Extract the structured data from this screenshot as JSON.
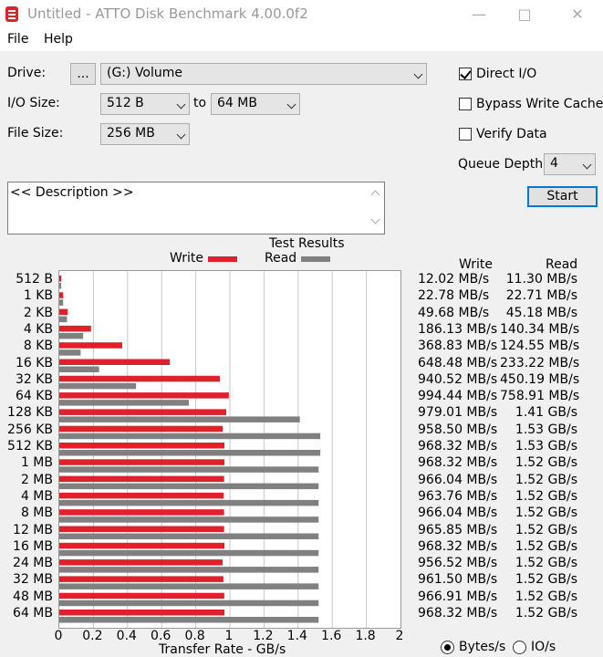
{
  "window": {
    "title": "Untitled - ATTO Disk Benchmark 4.00.0f2"
  },
  "menu": {
    "file": "File",
    "help": "Help"
  },
  "drive": {
    "label": "Drive:",
    "browse": "...",
    "value": "(G:) Volume"
  },
  "io_size": {
    "label": "I/O Size:",
    "from": "512 B",
    "to_label": "to",
    "to": "64 MB"
  },
  "file_size": {
    "label": "File Size:",
    "value": "256 MB"
  },
  "options": {
    "direct_io": {
      "label": "Direct I/O",
      "checked": true
    },
    "bypass_write_cache": {
      "label": "Bypass Write Cache",
      "checked": false
    },
    "verify_data": {
      "label": "Verify Data",
      "checked": false
    },
    "queue_depth_label": "Queue Depth:",
    "queue_depth": "4"
  },
  "start_button": "Start",
  "description": "<< Description >>",
  "results": {
    "title": "Test Results",
    "write_legend": "Write",
    "read_legend": "Read",
    "write_header": "Write",
    "read_header": "Read"
  },
  "units": {
    "bytes": "Bytes/s",
    "io": "IO/s",
    "selected": "bytes"
  },
  "colors": {
    "write": "#e0202a",
    "read": "#808080"
  },
  "chart_data": {
    "type": "bar",
    "orientation": "horizontal",
    "xlabel": "Transfer Rate - GB/s",
    "xlim": [
      0,
      2
    ],
    "xticks": [
      "0",
      "0.2",
      "0.4",
      "0.6",
      "0.8",
      "1",
      "1.2",
      "1.4",
      "1.6",
      "1.8",
      "2"
    ],
    "grid": true,
    "categories": [
      "512 B",
      "1 KB",
      "2 KB",
      "4 KB",
      "8 KB",
      "16 KB",
      "32 KB",
      "64 KB",
      "128 KB",
      "256 KB",
      "512 KB",
      "1 MB",
      "2 MB",
      "4 MB",
      "8 MB",
      "12 MB",
      "16 MB",
      "24 MB",
      "32 MB",
      "48 MB",
      "64 MB"
    ],
    "series": [
      {
        "name": "Write",
        "values": [
          0.012,
          0.0228,
          0.0497,
          0.186,
          0.369,
          0.648,
          0.941,
          0.994,
          0.979,
          0.9585,
          0.968,
          0.968,
          0.966,
          0.964,
          0.966,
          0.966,
          0.968,
          0.957,
          0.962,
          0.967,
          0.968
        ],
        "labels": [
          "12.02 MB/s",
          "22.78 MB/s",
          "49.68 MB/s",
          "186.13 MB/s",
          "368.83 MB/s",
          "648.48 MB/s",
          "940.52 MB/s",
          "994.44 MB/s",
          "979.01 MB/s",
          "958.50 MB/s",
          "968.32 MB/s",
          "968.32 MB/s",
          "966.04 MB/s",
          "963.76 MB/s",
          "966.04 MB/s",
          "965.85 MB/s",
          "968.32 MB/s",
          "956.52 MB/s",
          "961.50 MB/s",
          "966.91 MB/s",
          "968.32 MB/s"
        ]
      },
      {
        "name": "Read",
        "values": [
          0.0113,
          0.0227,
          0.0452,
          0.14,
          0.125,
          0.233,
          0.45,
          0.759,
          1.41,
          1.53,
          1.53,
          1.52,
          1.52,
          1.52,
          1.52,
          1.52,
          1.52,
          1.52,
          1.52,
          1.52,
          1.52
        ],
        "labels": [
          "11.30 MB/s",
          "22.71 MB/s",
          "45.18 MB/s",
          "140.34 MB/s",
          "124.55 MB/s",
          "233.22 MB/s",
          "450.19 MB/s",
          "758.91 MB/s",
          "1.41 GB/s",
          "1.53 GB/s",
          "1.53 GB/s",
          "1.52 GB/s",
          "1.52 GB/s",
          "1.52 GB/s",
          "1.52 GB/s",
          "1.52 GB/s",
          "1.52 GB/s",
          "1.52 GB/s",
          "1.52 GB/s",
          "1.52 GB/s",
          "1.52 GB/s"
        ]
      }
    ]
  }
}
